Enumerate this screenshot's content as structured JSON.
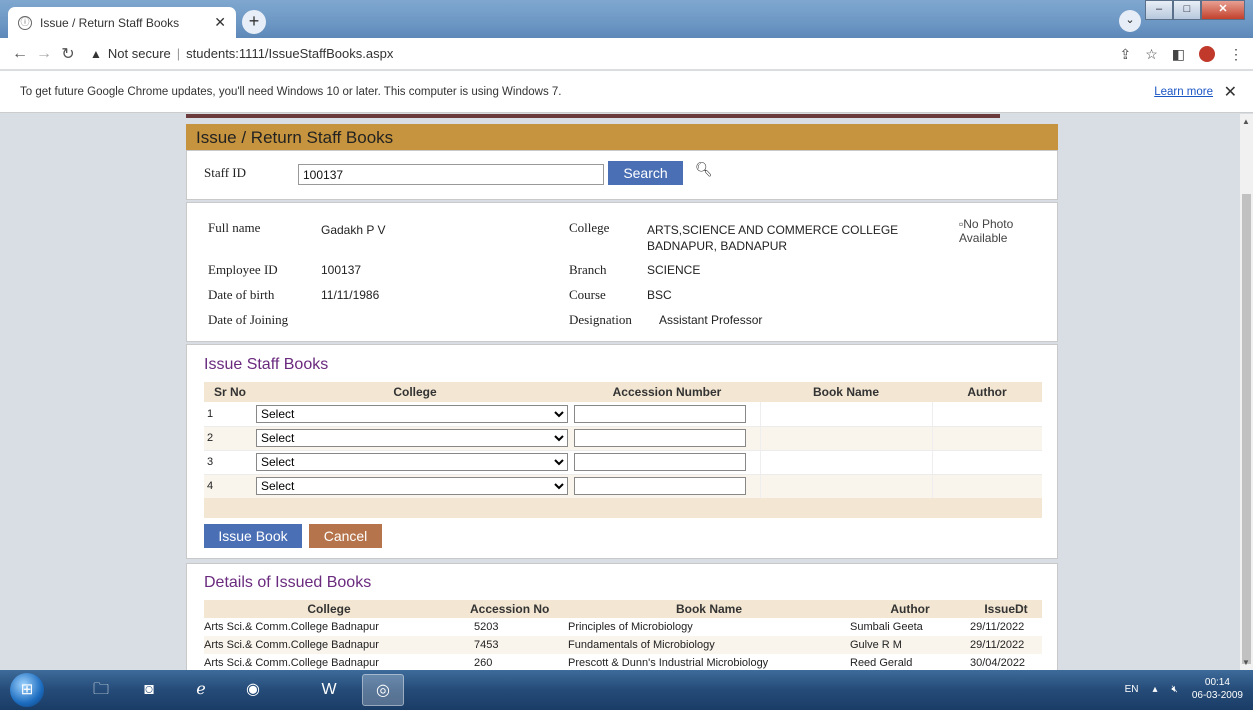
{
  "browser": {
    "tab_title": "Issue / Return Staff Books",
    "tab_icon": "ⓘ",
    "address_warning": "Not secure",
    "url": "students:1111/IssueStaffBooks.aspx"
  },
  "infobar": {
    "message": "To get future Google Chrome updates, you'll need Windows 10 or later. This computer is using Windows 7.",
    "learn_more": "Learn more"
  },
  "page": {
    "header_title": "Issue / Return Staff Books",
    "search": {
      "label": "Staff ID",
      "value": "100137",
      "button": "Search"
    },
    "staff": {
      "full_name_label": "Full name",
      "full_name": "Gadakh P V",
      "college_label": "College",
      "college_line1": "ARTS,SCIENCE AND COMMERCE COLLEGE",
      "college_line2": "BADNAPUR, BADNAPUR",
      "employee_id_label": "Employee ID",
      "employee_id": "100137",
      "branch_label": "Branch",
      "branch": "SCIENCE",
      "dob_label": "Date of birth",
      "dob": "11/11/1986",
      "course_label": "Course",
      "course": "BSC",
      "doj_label": "Date of Joining",
      "designation_label": "Designation",
      "designation": "Assistant Professor",
      "photo_alt_line1": "No Photo",
      "photo_alt_line2": "Available"
    },
    "issue": {
      "title": "Issue Staff Books",
      "columns": [
        "Sr No",
        "College",
        "Accession Number",
        "Book Name",
        "Author"
      ],
      "rows": [
        {
          "sr": "1",
          "college": "Select"
        },
        {
          "sr": "2",
          "college": "Select"
        },
        {
          "sr": "3",
          "college": "Select"
        },
        {
          "sr": "4",
          "college": "Select"
        }
      ],
      "issue_button": "Issue Book",
      "cancel_button": "Cancel"
    },
    "issued": {
      "title": "Details of Issued Books",
      "columns": [
        "College",
        "Accession No",
        "Book Name",
        "Author",
        "IssueDt"
      ],
      "rows": [
        [
          "Arts Sci.& Comm.College Badnapur",
          "5203",
          "Principles of Microbiology",
          "Sumbali Geeta",
          "29/11/2022"
        ],
        [
          "Arts Sci.& Comm.College Badnapur",
          "7453",
          "Fundamentals of Microbiology",
          "Gulve R M",
          "29/11/2022"
        ],
        [
          "Arts Sci.& Comm.College Badnapur",
          "260",
          "Prescott & Dunn's Industrial Microbiology",
          "Reed Gerald",
          "30/04/2022"
        ]
      ]
    }
  },
  "taskbar": {
    "lang": "EN",
    "time": "00:14",
    "date": "06-03-2009"
  },
  "colors": {
    "header_bar": "#c6943e",
    "primary_button": "#4a6fb5",
    "cancel_button": "#b5744b",
    "section_title": "#6a2a7e"
  }
}
